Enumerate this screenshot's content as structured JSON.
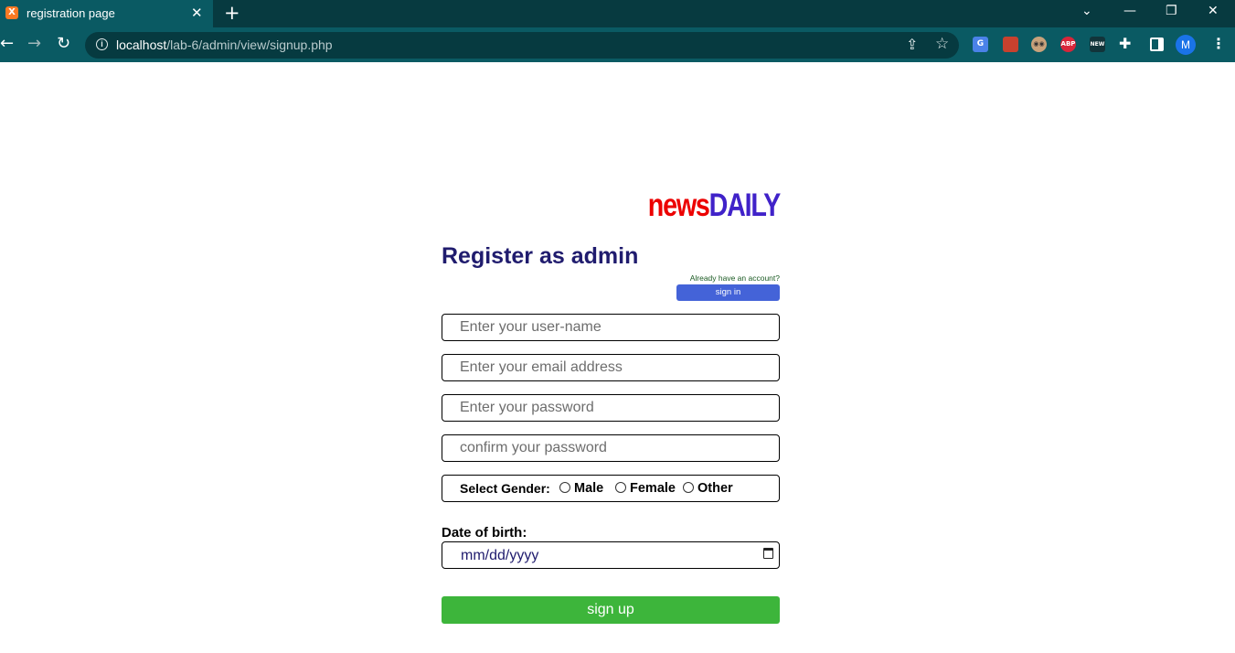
{
  "browser": {
    "tab_title": "registration page",
    "tab_favicon": "xampp-icon",
    "tab_close": "✕",
    "new_tab": "+",
    "url_host": "localhost",
    "url_path": "/lab-6/admin/view/signup.php",
    "profile_initial": "M",
    "window_controls": [
      "⌄",
      "—",
      "❐",
      "✕"
    ],
    "extensions": [
      "google-translate-icon",
      "book-extension-icon",
      "owl-extension-icon",
      "adblock-plus-icon",
      "new-extension-icon"
    ],
    "ext_labels": {
      "translate": "G",
      "abp": "ABP",
      "new": "NEW"
    }
  },
  "page": {
    "logo_news": "news",
    "logo_daily": "DAILY",
    "title": "Register as admin",
    "already_text": "Already have an account?",
    "signin_label": "sign in",
    "username_placeholder": "Enter your user-name",
    "email_placeholder": "Enter your email address",
    "password_placeholder": "Enter your password",
    "confirm_placeholder": "confirm your password",
    "gender_label": "Select Gender:",
    "gender_options": [
      "Male",
      "Female",
      "Other"
    ],
    "dob_label": "Date of birth:",
    "dob_value": "mm/dd/yyyy",
    "signup_label": "sign up"
  },
  "colors": {
    "chrome_dark": "#073a40",
    "chrome_tab": "#0a5a63",
    "logo_news": "#ec0000",
    "logo_daily": "#4022c9",
    "title": "#201c6e",
    "signin_button": "#4463d8",
    "signup_button": "#3db53b"
  }
}
